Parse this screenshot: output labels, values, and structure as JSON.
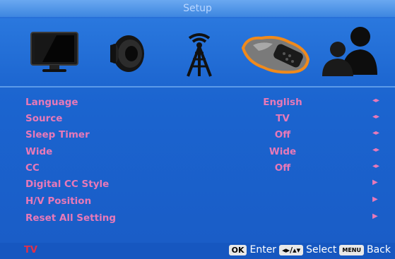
{
  "title": "Setup",
  "icons": [
    {
      "name": "picture-tv-icon",
      "selected": false
    },
    {
      "name": "sound-speaker-icon",
      "selected": false
    },
    {
      "name": "channel-antenna-icon",
      "selected": false
    },
    {
      "name": "setup-hand-remote-icon",
      "selected": true
    },
    {
      "name": "parental-users-icon",
      "selected": false
    }
  ],
  "menu": {
    "items": [
      {
        "label": "Language",
        "value": "English",
        "arrow": "◂▸"
      },
      {
        "label": "Source",
        "value": "TV",
        "arrow": "◂▸"
      },
      {
        "label": "Sleep Timer",
        "value": "Off",
        "arrow": "◂▸"
      },
      {
        "label": "Wide",
        "value": "Wide",
        "arrow": "◂▸"
      },
      {
        "label": "CC",
        "value": "Off",
        "arrow": "◂▸"
      },
      {
        "label": "Digital CC Style",
        "value": "",
        "arrow": "▶"
      },
      {
        "label": "H/V Position",
        "value": "",
        "arrow": "▶"
      },
      {
        "label": "Reset All Setting",
        "value": "",
        "arrow": "▶"
      }
    ]
  },
  "footer": {
    "source": "TV",
    "ok_key": "OK",
    "ok_text": "Enter",
    "nav_key": "◂▸/▴▾",
    "nav_text": "Select",
    "menu_key": "MENU",
    "menu_text": "Back"
  },
  "colors": {
    "label": "#e879b8",
    "source_label": "#e0304a",
    "background": "#1b64cf",
    "selected_icon": "#f08a1c"
  }
}
